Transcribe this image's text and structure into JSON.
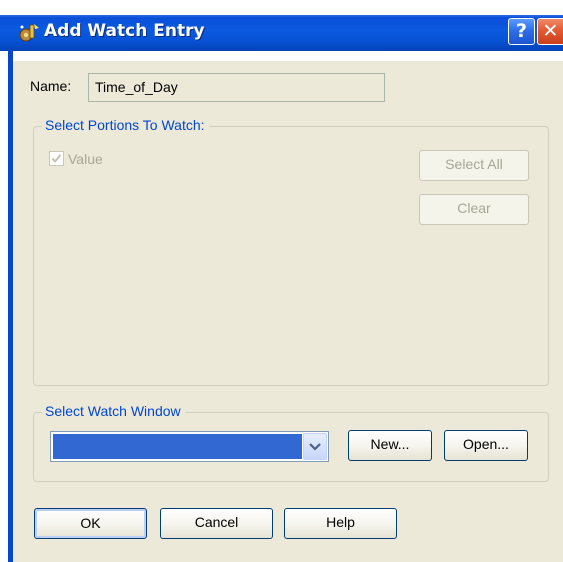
{
  "window": {
    "title": "Add Watch Entry",
    "help_glyph": "?",
    "close_glyph": "✕"
  },
  "name_field": {
    "label": "Name:",
    "value": "Time_of_Day"
  },
  "portions_group": {
    "label": "Select Portions To Watch:",
    "items": [
      {
        "label": "Value",
        "checked": true,
        "enabled": false
      }
    ],
    "select_all_label": "Select All",
    "clear_label": "Clear"
  },
  "watch_window_group": {
    "label": "Select Watch Window",
    "selected_value": "",
    "new_label": "New...",
    "open_label": "Open..."
  },
  "footer": {
    "ok_label": "OK",
    "cancel_label": "Cancel",
    "help_label": "Help"
  },
  "colors": {
    "titlebar": "#0a4ed8",
    "dialog_face": "#ece9d8",
    "disabled_text": "#a7a697",
    "group_label_blue": "#0046d5",
    "selection": "#3168d2"
  },
  "icons": {
    "title": "gear-sparkle-icon",
    "help": "question-icon",
    "close": "close-icon",
    "checkbox": "checkmark-icon",
    "dropdown": "chevron-down-icon"
  }
}
